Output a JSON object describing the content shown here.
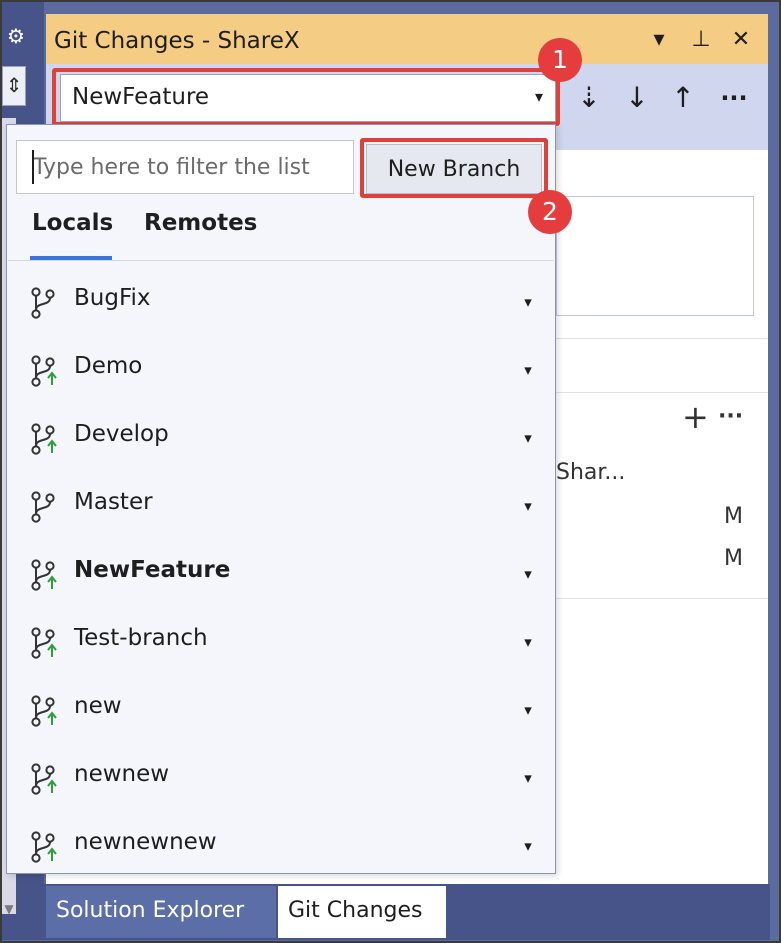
{
  "window": {
    "title": "Git Changes - ShareX",
    "dropdown_btn": "▾",
    "pin_btn": "⊥",
    "close_btn": "✕"
  },
  "branch_selector": {
    "current": "NewFeature",
    "arrow": "▾"
  },
  "toolbar": {
    "fetch": "⇣",
    "pull": "↓",
    "push": "↑",
    "more": "···"
  },
  "callouts": {
    "one": "1",
    "two": "2"
  },
  "dropdown": {
    "filter_placeholder": "Type here to filter the list",
    "new_branch_label": "New Branch",
    "tabs": [
      "Locals",
      "Remotes"
    ],
    "branches": [
      {
        "name": "BugFix",
        "tracked": false,
        "current": false
      },
      {
        "name": "Demo",
        "tracked": true,
        "current": false
      },
      {
        "name": "Develop",
        "tracked": true,
        "current": false
      },
      {
        "name": "Master",
        "tracked": false,
        "current": false
      },
      {
        "name": "NewFeature",
        "tracked": true,
        "current": true
      },
      {
        "name": "Test-branch",
        "tracked": true,
        "current": false
      },
      {
        "name": "new",
        "tracked": true,
        "current": false
      },
      {
        "name": "newnew",
        "tracked": true,
        "current": false
      },
      {
        "name": "newnewnew",
        "tracked": true,
        "current": false
      }
    ],
    "row_arrow": "▾"
  },
  "background": {
    "add_icon": "+",
    "more_icon": "···",
    "repo_partial": "Shar...",
    "status_1": "M",
    "status_2": "M"
  },
  "left_strip": {
    "gear": "⚙",
    "tool": "⇕",
    "scroll_down": "▼"
  },
  "bottom_tabs": {
    "solution_explorer": "Solution Explorer",
    "git_changes": "Git Changes"
  },
  "colors": {
    "title_bar": "#f5cc84",
    "accent_blue": "#3a74d8",
    "callout_red": "#e53d3d",
    "branch_green": "#2e9e3a"
  }
}
